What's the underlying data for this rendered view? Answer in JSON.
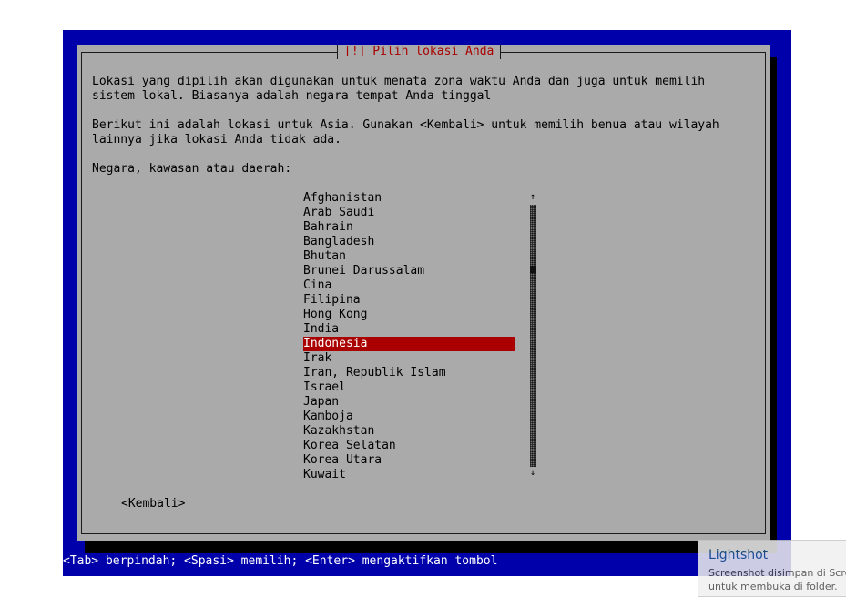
{
  "dialog": {
    "title": "[!] Pilih lokasi Anda",
    "intro_line1": "Lokasi yang dipilih akan digunakan untuk menata zona waktu Anda dan juga untuk memilih",
    "intro_line2": "sistem lokal. Biasanya adalah negara tempat Anda tinggal",
    "info_line1": "Berikut ini adalah lokasi untuk Asia. Gunakan <Kembali> untuk memilih benua atau wilayah",
    "info_line2": "lainnya jika lokasi Anda tidak ada.",
    "prompt": "Negara, kawasan atau daerah:",
    "countries": [
      "Afghanistan",
      "Arab Saudi",
      "Bahrain",
      "Bangladesh",
      "Bhutan",
      "Brunei Darussalam",
      "Cina",
      "Filipina",
      "Hong Kong",
      "India",
      "Indonesia",
      "Irak",
      "Iran, Republik Islam",
      "Israel",
      "Japan",
      "Kamboja",
      "Kazakhstan",
      "Korea Selatan",
      "Korea Utara",
      "Kuwait"
    ],
    "selected": "Indonesia",
    "scroll_up_glyph": "↑",
    "scroll_down_glyph": "↓",
    "back_label": "<Kembali>"
  },
  "help_bar": "<Tab> berpindah; <Spasi> memilih; <Enter> mengaktifkan tombol",
  "toast": {
    "title": "Lightshot",
    "line1": "Screenshot disimpan di Scree",
    "line2": "untuk membuka di folder."
  },
  "colors": {
    "screen_bg": "#0000aa",
    "dialog_bg": "#aaaaaa",
    "title_color": "#aa0000",
    "selection_bg": "#aa0000"
  }
}
